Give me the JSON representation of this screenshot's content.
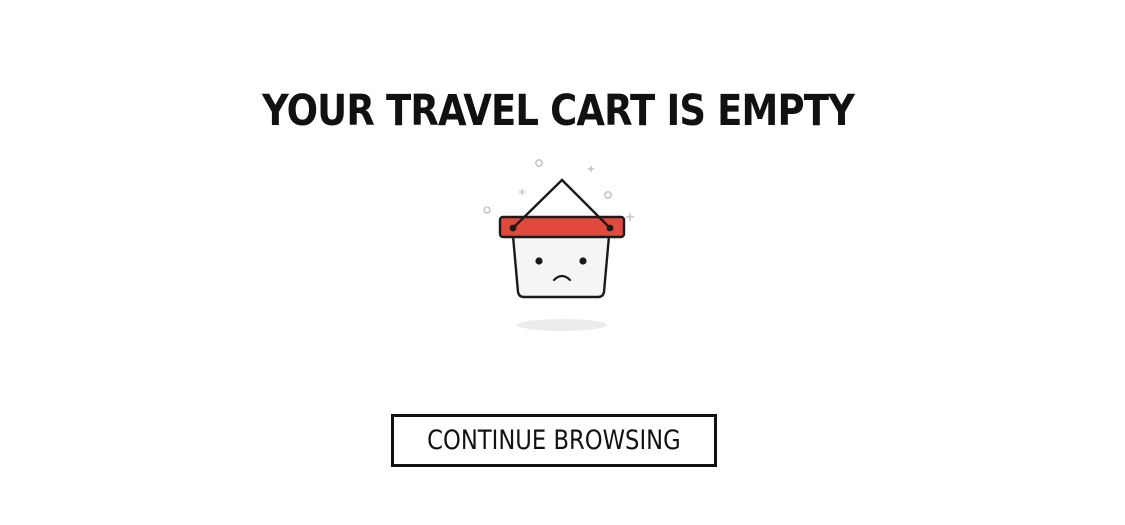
{
  "heading": {
    "prefix": "YOUR TRAVEL CART IS ",
    "emphasis": "EMPTY"
  },
  "illustration": {
    "icon": "sad-empty-basket-icon",
    "colors": {
      "rim": "#e0493c",
      "body": "#f5f5f5",
      "outline": "#1a1a1a",
      "shadow": "#ececec",
      "sparkle": "#bdbdbd"
    }
  },
  "actions": {
    "continue_label": "CONTINUE BROWSING"
  }
}
